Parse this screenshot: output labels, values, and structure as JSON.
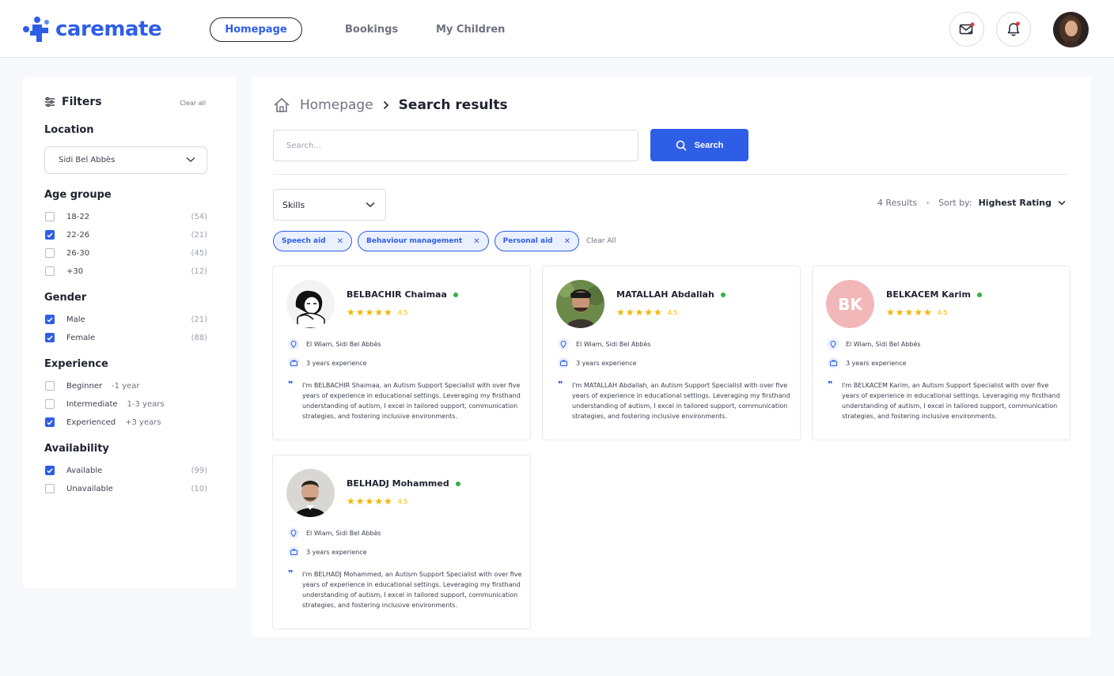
{
  "brand": {
    "name": "caremate",
    "color": "#2f5ee6"
  },
  "nav": {
    "items": [
      {
        "label": "Homepage",
        "active": true
      },
      {
        "label": "Bookings",
        "active": false
      },
      {
        "label": "My Children",
        "active": false
      }
    ]
  },
  "header_icons": [
    "mail-icon",
    "bell-icon",
    "avatar"
  ],
  "filters": {
    "title": "Filters",
    "clear_label": "Clear all",
    "location": {
      "title": "Location",
      "value": "Sidi Bel Abbès"
    },
    "age": {
      "title": "Age groupe",
      "options": [
        {
          "label": "18-22",
          "count": "(54)",
          "checked": false
        },
        {
          "label": "22-26",
          "count": "(21)",
          "checked": true
        },
        {
          "label": "26-30",
          "count": "(45)",
          "checked": false
        },
        {
          "label": "+30",
          "count": "(12)",
          "checked": false
        }
      ]
    },
    "gender": {
      "title": "Gender",
      "options": [
        {
          "label": "Male",
          "count": "(21)",
          "checked": true
        },
        {
          "label": "Female",
          "count": "(88)",
          "checked": true
        }
      ]
    },
    "experience": {
      "title": "Experience",
      "options": [
        {
          "label": "Beginner",
          "sub": "-1 year",
          "checked": false
        },
        {
          "label": "Intermediate",
          "sub": "1-3 years",
          "checked": false
        },
        {
          "label": "Experienced",
          "sub": "+3 years",
          "checked": true
        }
      ]
    },
    "availability": {
      "title": "Availability",
      "options": [
        {
          "label": "Available",
          "count": "(99)",
          "checked": true
        },
        {
          "label": "Unavailable",
          "count": "(10)",
          "checked": false
        }
      ]
    }
  },
  "main": {
    "breadcrumb": {
      "home": "Homepage",
      "current": "Search results"
    },
    "search": {
      "placeholder": "Search...",
      "button": "Search"
    },
    "skills": {
      "label": "Skills"
    },
    "results": {
      "count": "4 Results",
      "sort_label": "Sort by:",
      "sort_value": "Highest Rating"
    },
    "tags": [
      "Speech aid",
      "Behaviour management",
      "Personal aid"
    ],
    "tags_clear": "Clear All",
    "cards": [
      {
        "name": "BELBACHIR Chaimaa",
        "rating": "4.5",
        "location": "El Wiam, Sidi Bel Abbès",
        "experience": "3 years experience",
        "bio": "I'm BELBACHIR Shaimaa, an Autism Support Specialist with over five years of experience in educational settings. Leveraging my firsthand understanding of autism, I excel in tailored support, communication strategies, and fostering inclusive environments.",
        "avatar": "illustration"
      },
      {
        "name": "MATALLAH Abdallah",
        "rating": "4.5",
        "location": "El Wiam, Sidi Bel Abbès",
        "experience": "3 years experience",
        "bio": "I'm MATALLAH Abdallah, an Autism Support Specialist with over five years of experience in educational settings. Leveraging my firsthand understanding of autism, I excel in tailored support, communication strategies, and fostering inclusive environments.",
        "avatar": "photo"
      },
      {
        "name": "BELKACEM Karim",
        "rating": "4.5",
        "location": "El Wiam, Sidi Bel Abbès",
        "experience": "3 years experience",
        "bio": "I'm BELKACEM Karim, an Autism Support Specialist with over five years of experience in educational settings. Leveraging my firsthand understanding of autism, I excel in tailored support, communication strategies, and fostering inclusive environments.",
        "initials": "BK"
      },
      {
        "name": "BELHADJ Mohammed",
        "rating": "4.5",
        "location": "El Wiam, Sidi Bel Abbès",
        "experience": "3 years experience",
        "bio": "I'm BELHADJ Mohammed, an Autism Support Specialist with over five years of experience in educational settings. Leveraging my firsthand understanding of autism, I excel in tailored support, communication strategies, and fostering inclusive environments.",
        "avatar": "photo"
      }
    ]
  },
  "colors": {
    "accent": "#2f5ee6",
    "online": "#2fb344",
    "star": "#f5b400",
    "notification": "#e53935"
  }
}
